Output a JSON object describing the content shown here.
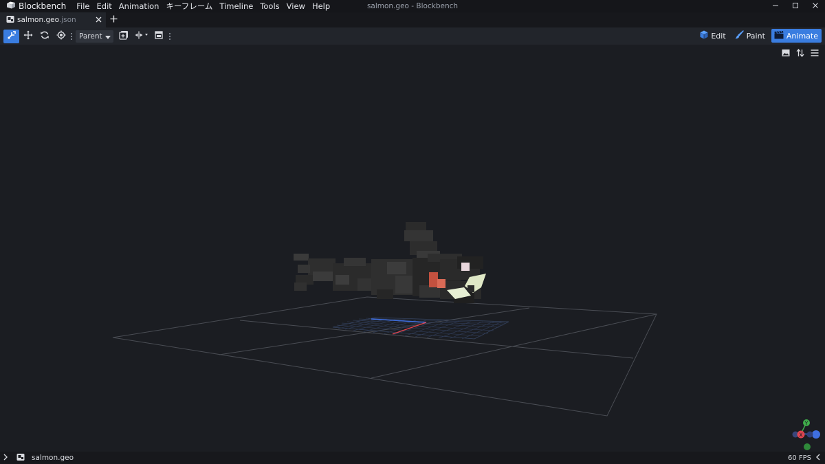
{
  "app": {
    "name": "Blockbench",
    "window_title": "salmon.geo - Blockbench"
  },
  "menu": {
    "items": [
      "File",
      "Edit",
      "Animation",
      "キーフレーム",
      "Timeline",
      "Tools",
      "View",
      "Help"
    ]
  },
  "tabs": [
    {
      "name": "salmon.geo",
      "ext": ".json"
    }
  ],
  "toolbar": {
    "space_select": "Parent",
    "tools": [
      "move-tool",
      "translate-tool",
      "rotate-tool",
      "pivot-tool"
    ]
  },
  "modes": [
    {
      "label": "Edit",
      "active": false
    },
    {
      "label": "Paint",
      "active": false
    },
    {
      "label": "Animate",
      "active": true
    }
  ],
  "gizmo": {
    "x_label": "X",
    "y_label": "Y"
  },
  "status": {
    "file": "salmon.geo",
    "fps": "60 FPS"
  },
  "colors": {
    "accent": "#3a7de0",
    "axis_x": "#e0454f",
    "axis_y": "#3fae4a",
    "axis_z": "#3f6fe0"
  }
}
